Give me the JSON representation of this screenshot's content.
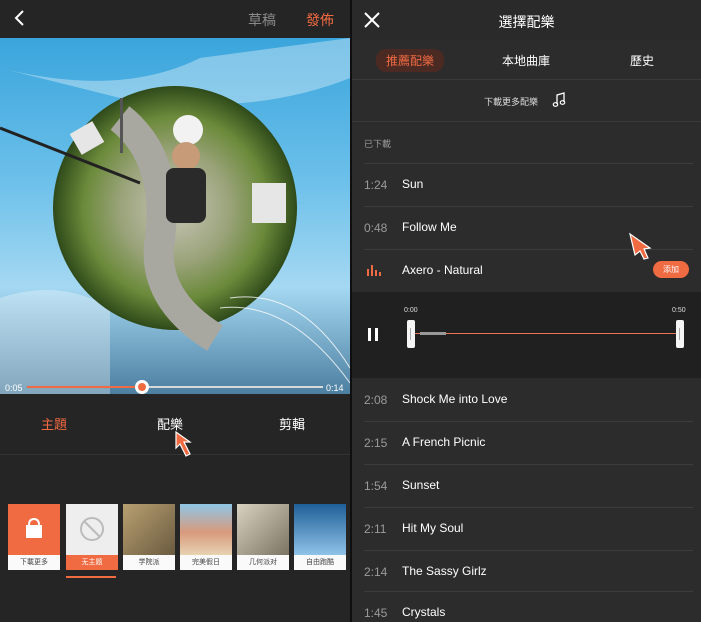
{
  "left": {
    "header": {
      "draft_label": "草稿",
      "publish_label": "發佈"
    },
    "video": {
      "current_time": "0:05",
      "total_time": "0:14",
      "progress": 0.39
    },
    "tabs": [
      {
        "label": "主題",
        "active": true
      },
      {
        "label": "配樂",
        "active": false
      },
      {
        "label": "剪輯",
        "active": false
      }
    ],
    "themes": [
      {
        "label": "下載更多",
        "icon": "bag-icon",
        "color": "#f06a42",
        "selected": false
      },
      {
        "label": "无主题",
        "icon": "no-symbol-icon",
        "color": "#eeeeee",
        "selected": true
      },
      {
        "label": "学院派",
        "icon": "photo-thumbnail",
        "color": "#8c7a5a",
        "selected": false
      },
      {
        "label": "完美假日",
        "icon": "photo-thumbnail",
        "color": "#c48a6a",
        "selected": false
      },
      {
        "label": "几何派对",
        "icon": "photo-thumbnail",
        "color": "#a09a88",
        "selected": false
      },
      {
        "label": "自由跑酷",
        "icon": "photo-thumbnail",
        "color": "#4f8ec2",
        "selected": false
      }
    ]
  },
  "right": {
    "header": {
      "title": "選擇配樂"
    },
    "tabs": [
      {
        "label": "推薦配樂",
        "active": true
      },
      {
        "label": "本地曲庫",
        "active": false
      },
      {
        "label": "歷史",
        "active": false
      }
    ],
    "download_more_label": "下載更多配樂",
    "downloaded_label": "已下載",
    "songs": [
      {
        "duration": "1:24",
        "name": "Sun"
      },
      {
        "duration": "0:48",
        "name": "Follow Me"
      },
      {
        "duration": "",
        "name": "Axero - Natural",
        "playing": true,
        "add_label": "添加"
      }
    ],
    "player": {
      "start_time": "0:00",
      "end_time": "0:50"
    },
    "more_songs": [
      {
        "duration": "2:08",
        "name": "Shock Me into Love"
      },
      {
        "duration": "2:15",
        "name": "A French Picnic"
      },
      {
        "duration": "1:54",
        "name": "Sunset"
      },
      {
        "duration": "2:11",
        "name": "Hit My Soul"
      },
      {
        "duration": "2:14",
        "name": "The Sassy Girlz"
      },
      {
        "duration": "1:45",
        "name": "Crystals"
      }
    ]
  },
  "colors": {
    "accent": "#f06a42",
    "background": "#262626"
  }
}
